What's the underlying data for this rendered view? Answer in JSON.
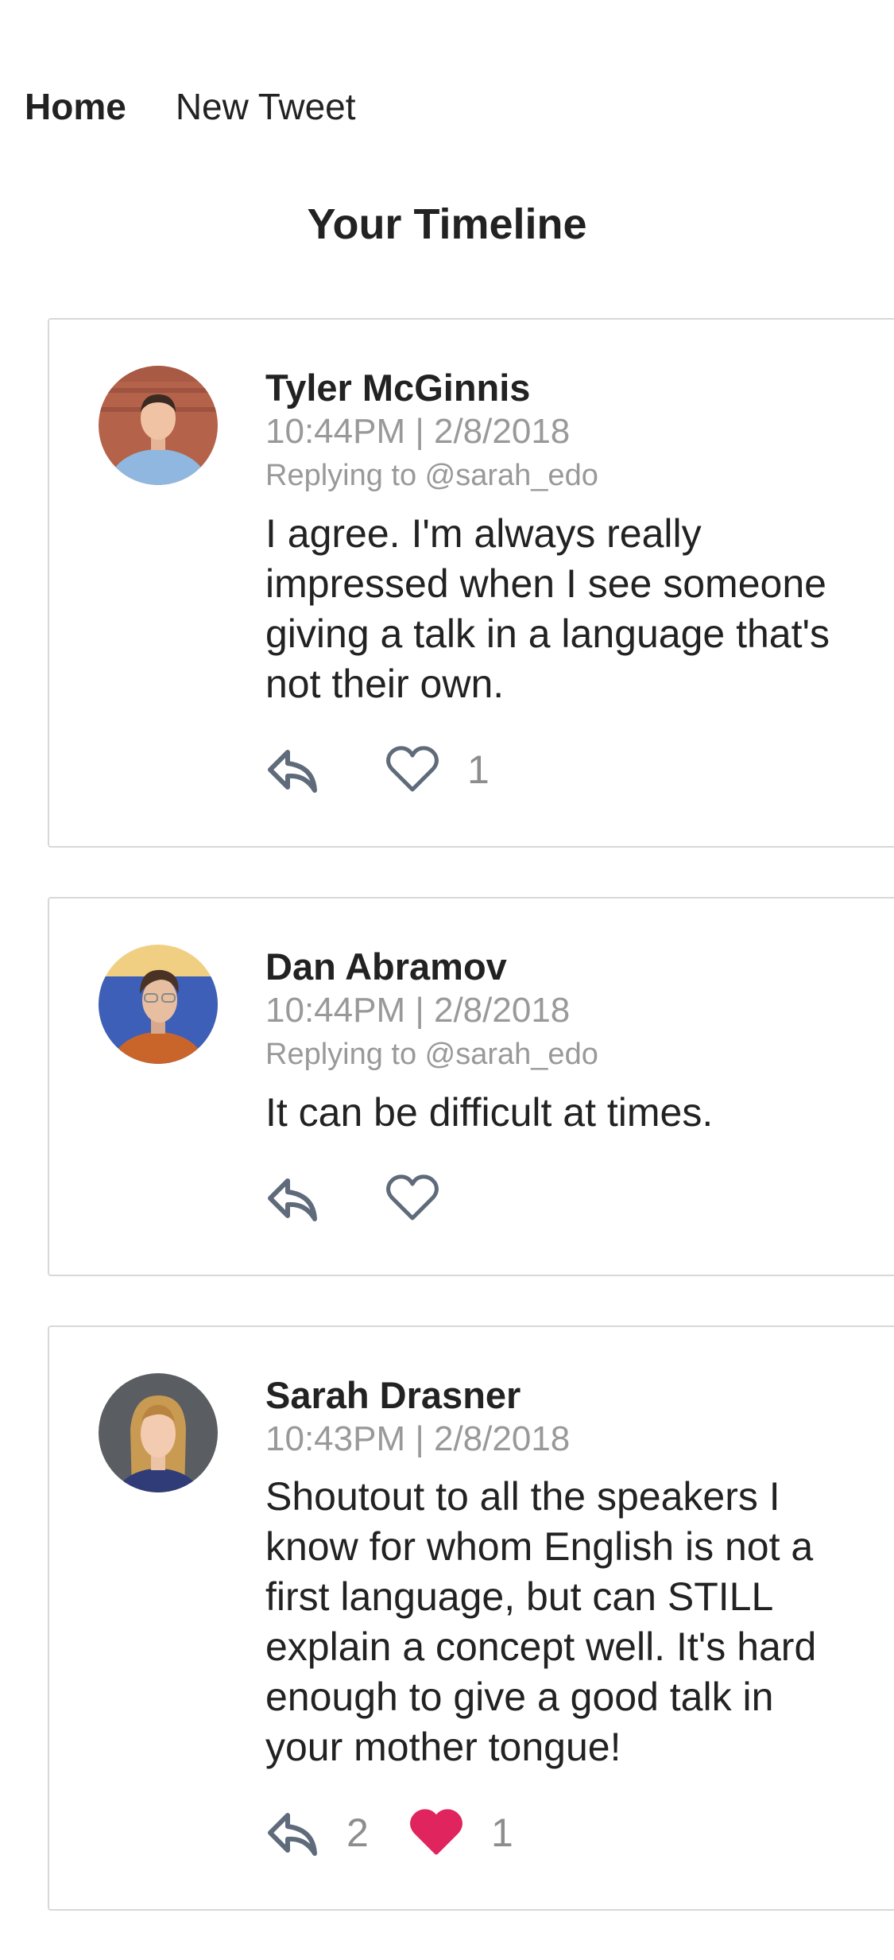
{
  "nav": {
    "home_label": "Home",
    "new_tweet_label": "New Tweet"
  },
  "page": {
    "title": "Your Timeline"
  },
  "colors": {
    "text": "#222222",
    "muted": "#999999",
    "icon": "#5f6b7a",
    "liked": "#e0245e",
    "border": "#d8d8d8"
  },
  "tweets": [
    {
      "author": "Tyler McGinnis",
      "timestamp": "10:44PM | 2/8/2018",
      "replying_to": "Replying to @sarah_edo",
      "text": "I agree. I'm always really impressed when I see someone giving a talk in a language that's not their own.",
      "reply_count": "",
      "like_count": "1",
      "liked": false,
      "avatar_icon": "avatar-tyler"
    },
    {
      "author": "Dan Abramov",
      "timestamp": "10:44PM | 2/8/2018",
      "replying_to": "Replying to @sarah_edo",
      "text": "It can be difficult at times.",
      "reply_count": "",
      "like_count": "",
      "liked": false,
      "avatar_icon": "avatar-dan"
    },
    {
      "author": "Sarah Drasner",
      "timestamp": "10:43PM | 2/8/2018",
      "replying_to": "",
      "text": "Shoutout to all the speakers I know for whom English is not a first language, but can STILL explain a concept well. It's hard enough to give a good talk in your mother tongue!",
      "reply_count": "2",
      "like_count": "1",
      "liked": true,
      "avatar_icon": "avatar-sarah"
    }
  ]
}
